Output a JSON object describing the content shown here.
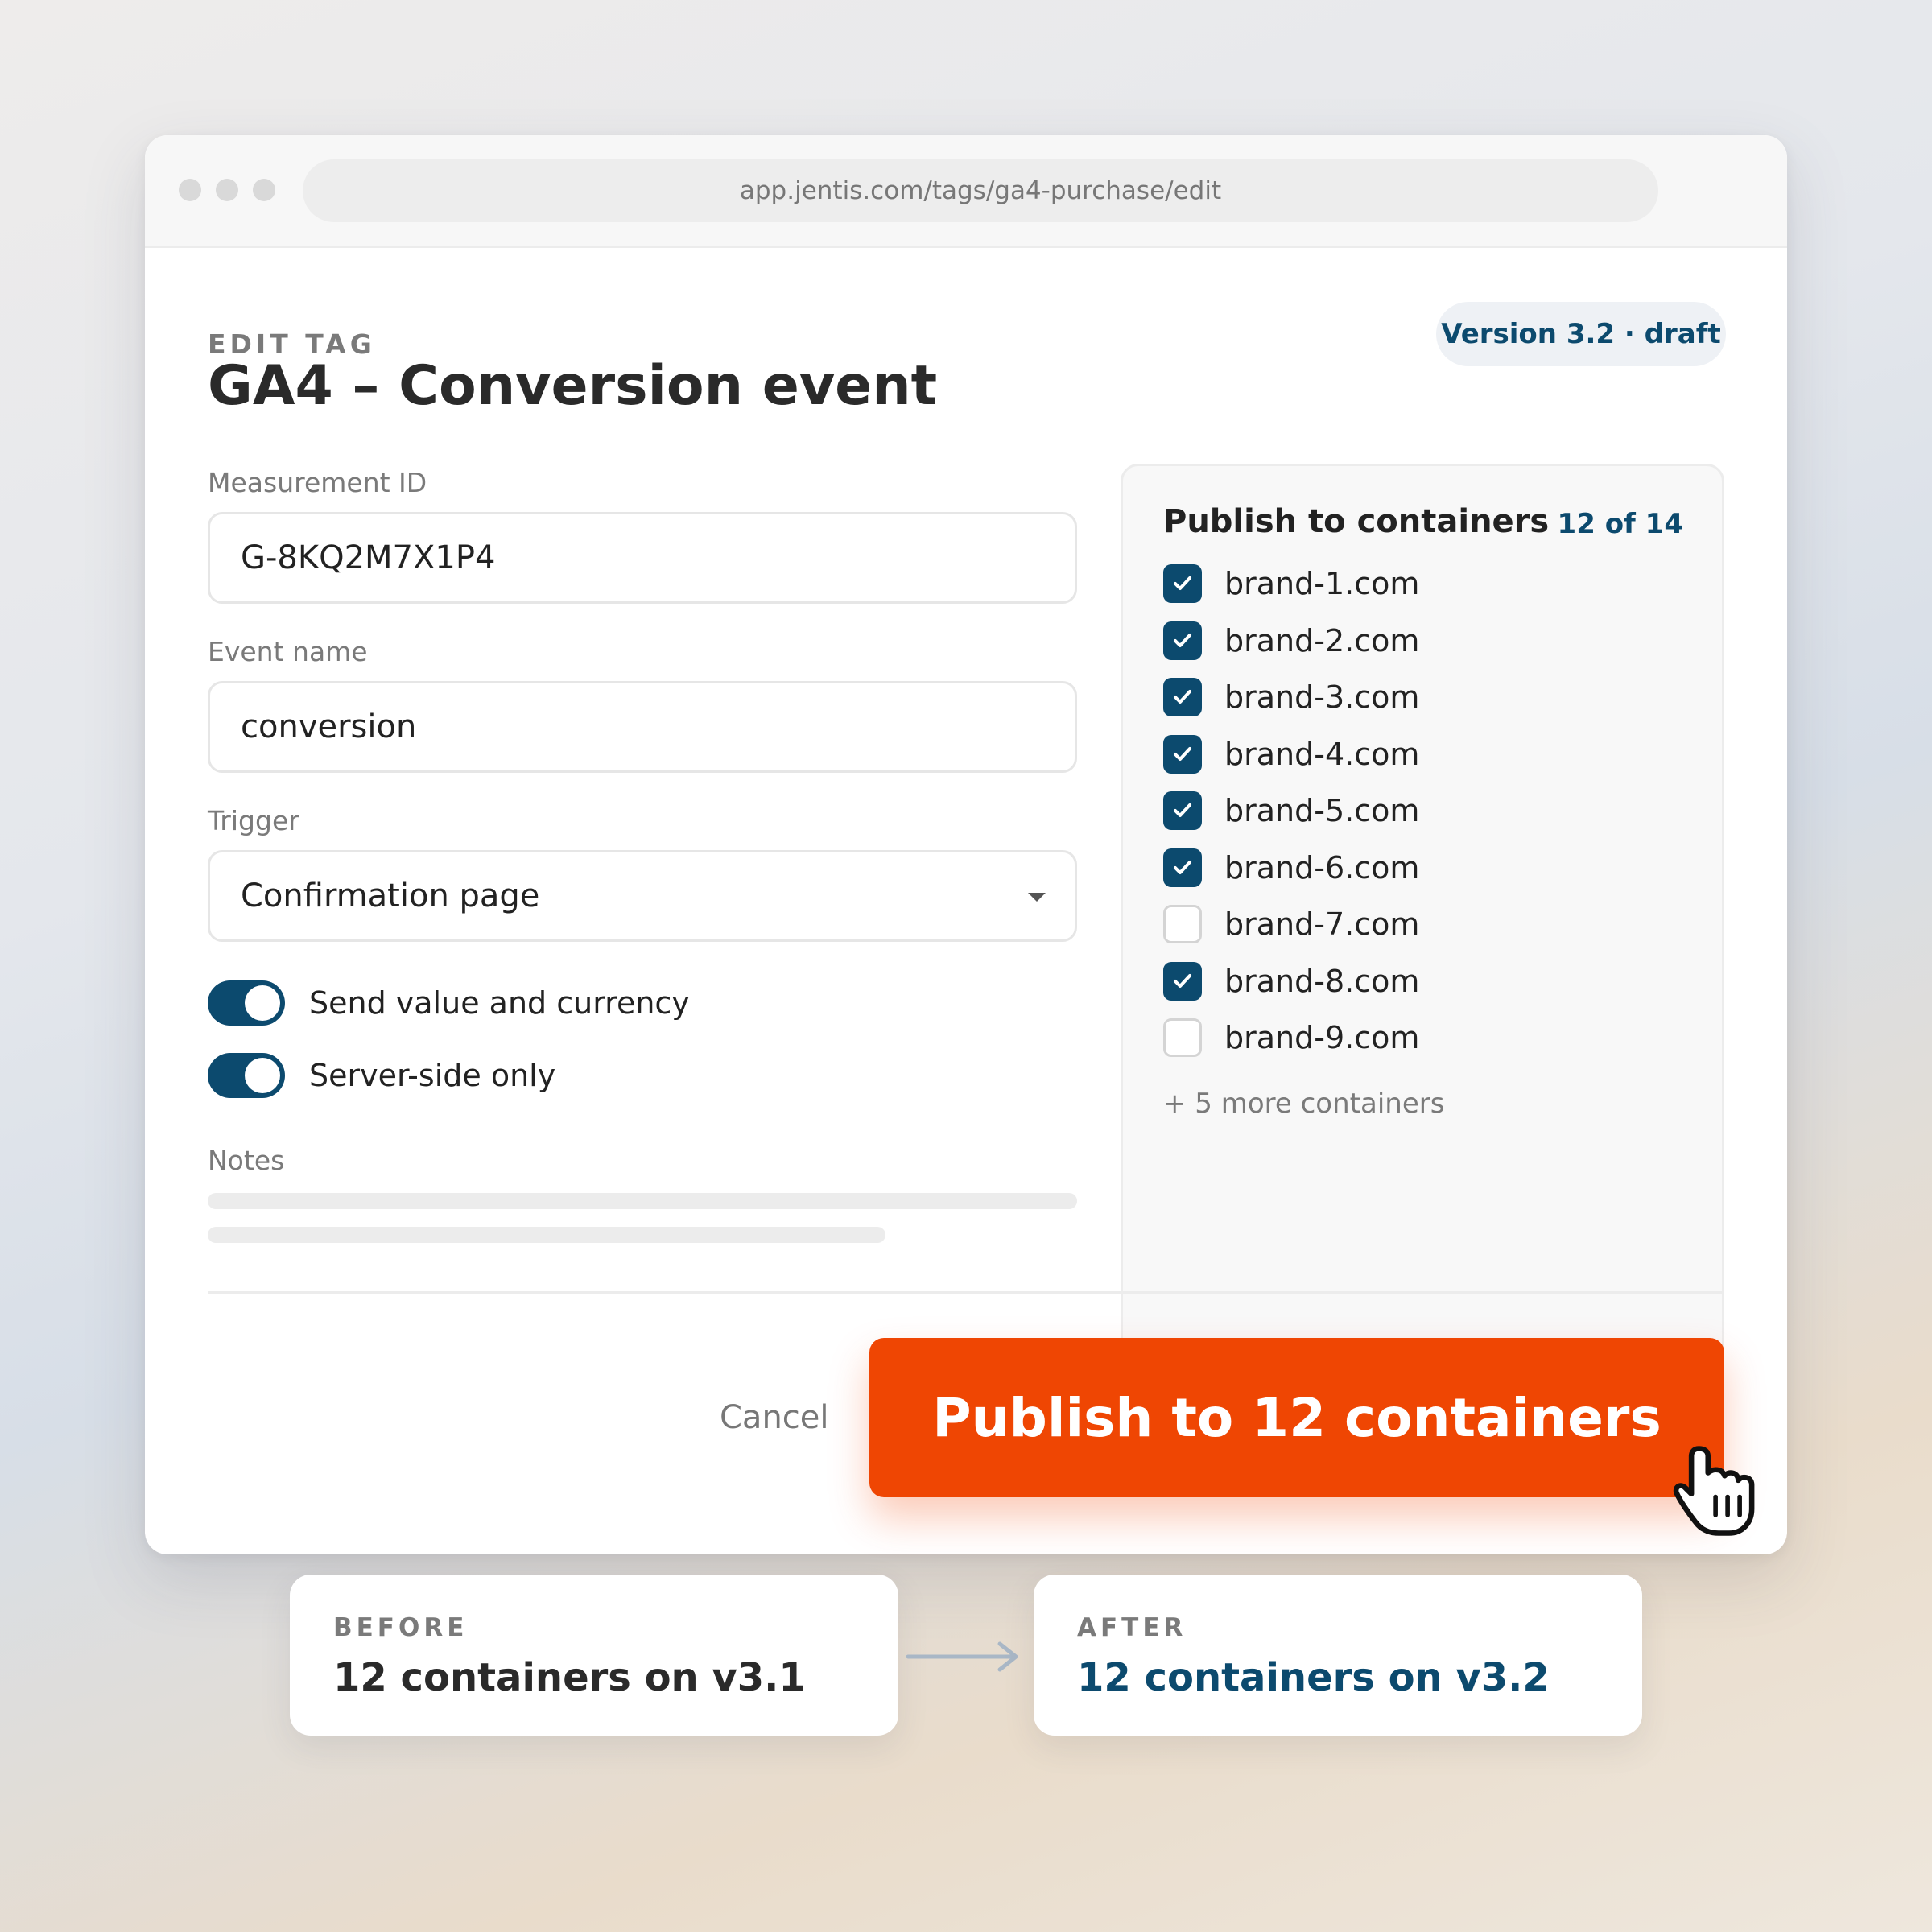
{
  "browser": {
    "url": "app.jentis.com/tags/ga4-purchase/edit"
  },
  "header": {
    "eyebrow": "EDIT TAG",
    "title": "GA4 – Conversion event",
    "version_badge": "Version 3.2 · draft"
  },
  "form": {
    "measurement_id": {
      "label": "Measurement ID",
      "value": "G-8KQ2M7X1P4"
    },
    "event_name": {
      "label": "Event name",
      "value": "conversion"
    },
    "trigger": {
      "label": "Trigger",
      "value": "Confirmation page"
    },
    "toggles": [
      {
        "label": "Send value and currency",
        "on": true
      },
      {
        "label": "Server-side only",
        "on": true
      }
    ],
    "notes_label": "Notes"
  },
  "containers": {
    "title": "Publish to containers",
    "count": "12 of 14",
    "items": [
      {
        "label": "brand-1.com",
        "checked": true
      },
      {
        "label": "brand-2.com",
        "checked": true
      },
      {
        "label": "brand-3.com",
        "checked": true
      },
      {
        "label": "brand-4.com",
        "checked": true
      },
      {
        "label": "brand-5.com",
        "checked": true
      },
      {
        "label": "brand-6.com",
        "checked": true
      },
      {
        "label": "brand-7.com",
        "checked": false
      },
      {
        "label": "brand-8.com",
        "checked": true
      },
      {
        "label": "brand-9.com",
        "checked": false
      }
    ],
    "more": "+ 5 more containers"
  },
  "actions": {
    "cancel": "Cancel",
    "publish": "Publish to 12 containers"
  },
  "comparison": {
    "before": {
      "label": "BEFORE",
      "value": "12 containers on v3.1"
    },
    "after": {
      "label": "AFTER",
      "value": "12 containers on v3.2"
    }
  },
  "colors": {
    "accent": "#ef4603",
    "primary": "#0c4a6e"
  },
  "icons": {
    "dropdown": "chevron-down-icon",
    "check": "checkmark-icon",
    "cursor": "hand-pointer-icon",
    "arrow": "arrow-right-icon"
  }
}
